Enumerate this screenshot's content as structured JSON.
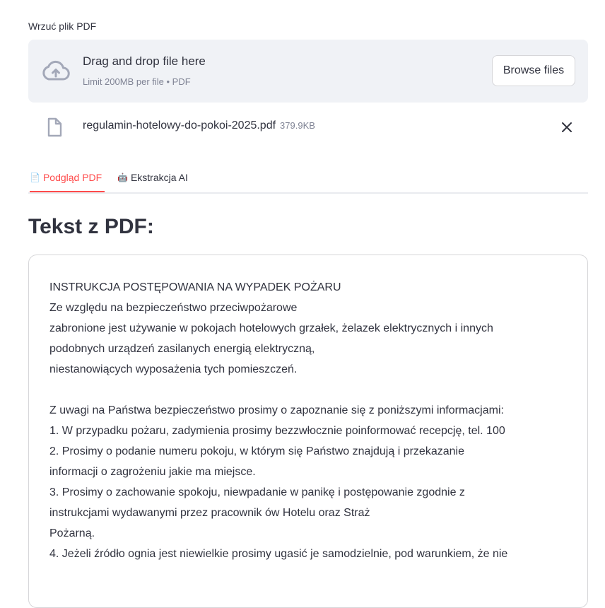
{
  "uploader": {
    "label": "Wrzuć plik PDF",
    "drop_title": "Drag and drop file here",
    "drop_subtitle": "Limit 200MB per file • PDF",
    "browse_label": "Browse files"
  },
  "file": {
    "name": "regulamin-hotelowy-do-pokoi-2025.pdf",
    "size": "379.9KB"
  },
  "tabs": [
    {
      "icon": "📄",
      "label": "Podgląd PDF",
      "active": true
    },
    {
      "icon": "🤖",
      "label": "Ekstrakcja AI",
      "active": false
    }
  ],
  "heading": "Tekst z PDF:",
  "pdf_text_lines": [
    "INSTRUKCJA POSTĘPOWANIA NA WYPADEK POŻARU",
    "Ze względu na bezpieczeństwo przeciwpożarowe",
    "zabronione jest używanie w pokojach hotelowych grzałek, żelazek elektrycznych i innych",
    "podobnych urządzeń zasilanych energią elektryczną,",
    "niestanowiących wyposażenia tych pomieszczeń.",
    "",
    "Z uwagi na Państwa bezpieczeństwo prosimy o zapoznanie się z poniższymi informacjami:",
    "1. W przypadku pożaru, zadymienia prosimy bezzwłocznie poinformować recepcję, tel. 100",
    "2. Prosimy o podanie numeru pokoju, w którym się Państwo znajdują i przekazanie",
    "informacji o zagrożeniu jakie ma miejsce.",
    "3. Prosimy o zachowanie spokoju, niewpadanie w panikę i postępowanie zgodnie z",
    "instrukcjami wydawanymi przez pracownik ów Hotelu oraz Straż",
    "Pożarną.",
    "4. Jeżeli źródło ognia jest niewielkie prosimy ugasić je samodzielnie, pod warunkiem, że nie"
  ],
  "colors": {
    "accent": "#ff4b4b",
    "dropzone_bg": "#f0f2f6",
    "text": "#31333f",
    "muted": "#808495"
  }
}
